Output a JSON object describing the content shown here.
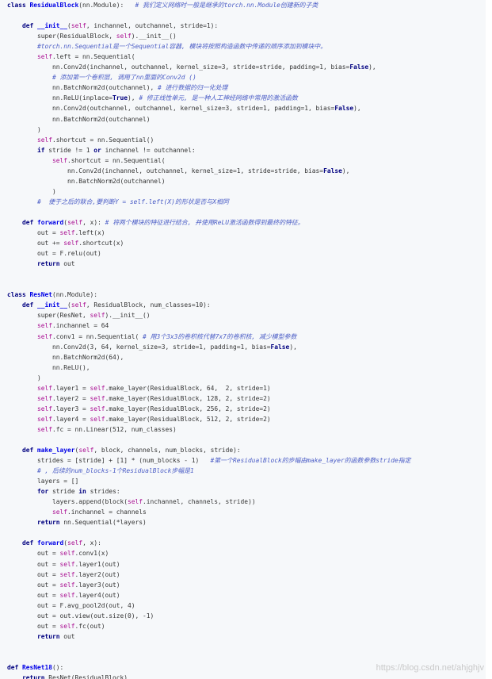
{
  "watermark": "https://blog.csdn.net/ahjghjv",
  "lines": [
    [
      [
        "kw",
        "class "
      ],
      [
        "fn",
        "ResidualBlock"
      ],
      [
        "n",
        "(nn.Module):   "
      ],
      [
        "co",
        "# 我们定义网络时一般是继承的torch.nn.Module创建新的子类"
      ]
    ],
    [
      [
        "n",
        ""
      ]
    ],
    [
      [
        "n",
        "    "
      ],
      [
        "kw",
        "def "
      ],
      [
        "fn",
        "__init__"
      ],
      [
        "n",
        "("
      ],
      [
        "self",
        "self"
      ],
      [
        "n",
        ", inchannel, outchannel, stride=1):"
      ]
    ],
    [
      [
        "n",
        "        super(ResidualBlock, "
      ],
      [
        "self",
        "self"
      ],
      [
        "n",
        ").__init__()"
      ]
    ],
    [
      [
        "n",
        "        "
      ],
      [
        "co",
        "#torch.nn.Sequential是一个Sequential容器, 模块将按照构造函数中传递的顺序添加到模块中。"
      ]
    ],
    [
      [
        "n",
        "        "
      ],
      [
        "self",
        "self"
      ],
      [
        "n",
        ".left = nn.Sequential("
      ]
    ],
    [
      [
        "n",
        "            nn.Conv2d(inchannel, outchannel, kernel_size=3, stride=stride, padding=1, bias="
      ],
      [
        "kw",
        "False"
      ],
      [
        "n",
        "),"
      ]
    ],
    [
      [
        "n",
        "            "
      ],
      [
        "co",
        "# 添加第一个卷积层, 调用了nn里面的Conv2d ()"
      ]
    ],
    [
      [
        "n",
        "            nn.BatchNorm2d(outchannel), "
      ],
      [
        "co",
        "# 进行数据的归一化处理"
      ]
    ],
    [
      [
        "n",
        "            nn.ReLU(inplace="
      ],
      [
        "kw",
        "True"
      ],
      [
        "n",
        "), "
      ],
      [
        "co",
        "# 修正线性单元, 是一种人工神经网络中常用的激活函数"
      ]
    ],
    [
      [
        "n",
        "            nn.Conv2d(outchannel, outchannel, kernel_size=3, stride=1, padding=1, bias="
      ],
      [
        "kw",
        "False"
      ],
      [
        "n",
        "),"
      ]
    ],
    [
      [
        "n",
        "            nn.BatchNorm2d(outchannel)"
      ]
    ],
    [
      [
        "n",
        "        )"
      ]
    ],
    [
      [
        "n",
        "        "
      ],
      [
        "self",
        "self"
      ],
      [
        "n",
        ".shortcut = nn.Sequential()"
      ]
    ],
    [
      [
        "n",
        "        "
      ],
      [
        "kw",
        "if "
      ],
      [
        "n",
        "stride != 1 "
      ],
      [
        "kw",
        "or "
      ],
      [
        "n",
        "inchannel != outchannel:"
      ]
    ],
    [
      [
        "n",
        "            "
      ],
      [
        "self",
        "self"
      ],
      [
        "n",
        ".shortcut = nn.Sequential("
      ]
    ],
    [
      [
        "n",
        "                nn.Conv2d(inchannel, outchannel, kernel_size=1, stride=stride, bias="
      ],
      [
        "kw",
        "False"
      ],
      [
        "n",
        "),"
      ]
    ],
    [
      [
        "n",
        "                nn.BatchNorm2d(outchannel)"
      ]
    ],
    [
      [
        "n",
        "            )"
      ]
    ],
    [
      [
        "n",
        "        "
      ],
      [
        "co",
        "#  便于之后的联合,要判断Y = self.left(X)的形状是否与X相同"
      ]
    ],
    [
      [
        "n",
        ""
      ]
    ],
    [
      [
        "n",
        "    "
      ],
      [
        "kw",
        "def "
      ],
      [
        "fn",
        "forward"
      ],
      [
        "n",
        "("
      ],
      [
        "self",
        "self"
      ],
      [
        "n",
        ", x): "
      ],
      [
        "co",
        "# 将两个模块的特征进行结合, 并使用ReLU激活函数得到最终的特征。"
      ]
    ],
    [
      [
        "n",
        "        out = "
      ],
      [
        "self",
        "self"
      ],
      [
        "n",
        ".left(x)"
      ]
    ],
    [
      [
        "n",
        "        out += "
      ],
      [
        "self",
        "self"
      ],
      [
        "n",
        ".shortcut(x)"
      ]
    ],
    [
      [
        "n",
        "        out = F.relu(out)"
      ]
    ],
    [
      [
        "n",
        "        "
      ],
      [
        "kw",
        "return "
      ],
      [
        "n",
        "out"
      ]
    ],
    [
      [
        "n",
        ""
      ]
    ],
    [
      [
        "n",
        ""
      ]
    ],
    [
      [
        "kw",
        "class "
      ],
      [
        "fn",
        "ResNet"
      ],
      [
        "n",
        "(nn.Module):"
      ]
    ],
    [
      [
        "n",
        "    "
      ],
      [
        "kw",
        "def "
      ],
      [
        "fn",
        "__init__"
      ],
      [
        "n",
        "("
      ],
      [
        "self",
        "self"
      ],
      [
        "n",
        ", ResidualBlock, num_classes=10):"
      ]
    ],
    [
      [
        "n",
        "        super(ResNet, "
      ],
      [
        "self",
        "self"
      ],
      [
        "n",
        ").__init__()"
      ]
    ],
    [
      [
        "n",
        "        "
      ],
      [
        "self",
        "self"
      ],
      [
        "n",
        ".inchannel = 64"
      ]
    ],
    [
      [
        "n",
        "        "
      ],
      [
        "self",
        "self"
      ],
      [
        "n",
        ".conv1 = nn.Sequential( "
      ],
      [
        "co",
        "# 用3个3x3的卷积核代替7x7的卷积核, 减少模型参数"
      ]
    ],
    [
      [
        "n",
        "            nn.Conv2d(3, 64, kernel_size=3, stride=1, padding=1, bias="
      ],
      [
        "kw",
        "False"
      ],
      [
        "n",
        "),"
      ]
    ],
    [
      [
        "n",
        "            nn.BatchNorm2d(64),"
      ]
    ],
    [
      [
        "n",
        "            nn.ReLU(),"
      ]
    ],
    [
      [
        "n",
        "        )"
      ]
    ],
    [
      [
        "n",
        "        "
      ],
      [
        "self",
        "self"
      ],
      [
        "n",
        ".layer1 = "
      ],
      [
        "self",
        "self"
      ],
      [
        "n",
        ".make_layer(ResidualBlock, 64,  2, stride=1)"
      ]
    ],
    [
      [
        "n",
        "        "
      ],
      [
        "self",
        "self"
      ],
      [
        "n",
        ".layer2 = "
      ],
      [
        "self",
        "self"
      ],
      [
        "n",
        ".make_layer(ResidualBlock, 128, 2, stride=2)"
      ]
    ],
    [
      [
        "n",
        "        "
      ],
      [
        "self",
        "self"
      ],
      [
        "n",
        ".layer3 = "
      ],
      [
        "self",
        "self"
      ],
      [
        "n",
        ".make_layer(ResidualBlock, 256, 2, stride=2)"
      ]
    ],
    [
      [
        "n",
        "        "
      ],
      [
        "self",
        "self"
      ],
      [
        "n",
        ".layer4 = "
      ],
      [
        "self",
        "self"
      ],
      [
        "n",
        ".make_layer(ResidualBlock, 512, 2, stride=2)"
      ]
    ],
    [
      [
        "n",
        "        "
      ],
      [
        "self",
        "self"
      ],
      [
        "n",
        ".fc = nn.Linear(512, num_classes)"
      ]
    ],
    [
      [
        "n",
        ""
      ]
    ],
    [
      [
        "n",
        "    "
      ],
      [
        "kw",
        "def "
      ],
      [
        "fn",
        "make_layer"
      ],
      [
        "n",
        "("
      ],
      [
        "self",
        "self"
      ],
      [
        "n",
        ", block, channels, num_blocks, stride):"
      ]
    ],
    [
      [
        "n",
        "        strides = [stride] + [1] * (num_blocks - 1)   "
      ],
      [
        "co",
        "#第一个ResidualBlock的步幅由make_layer的函数参数stride指定"
      ]
    ],
    [
      [
        "n",
        "        "
      ],
      [
        "co",
        "# , 后续的num_blocks-1个ResidualBlock步幅是1"
      ]
    ],
    [
      [
        "n",
        "        layers = []"
      ]
    ],
    [
      [
        "n",
        "        "
      ],
      [
        "kw",
        "for "
      ],
      [
        "n",
        "stride "
      ],
      [
        "kw",
        "in "
      ],
      [
        "n",
        "strides:"
      ]
    ],
    [
      [
        "n",
        "            layers.append(block("
      ],
      [
        "self",
        "self"
      ],
      [
        "n",
        ".inchannel, channels, stride))"
      ]
    ],
    [
      [
        "n",
        "            "
      ],
      [
        "self",
        "self"
      ],
      [
        "n",
        ".inchannel = channels"
      ]
    ],
    [
      [
        "n",
        "        "
      ],
      [
        "kw",
        "return "
      ],
      [
        "n",
        "nn.Sequential(*layers)"
      ]
    ],
    [
      [
        "n",
        ""
      ]
    ],
    [
      [
        "n",
        "    "
      ],
      [
        "kw",
        "def "
      ],
      [
        "fn",
        "forward"
      ],
      [
        "n",
        "("
      ],
      [
        "self",
        "self"
      ],
      [
        "n",
        ", x):"
      ]
    ],
    [
      [
        "n",
        "        out = "
      ],
      [
        "self",
        "self"
      ],
      [
        "n",
        ".conv1(x)"
      ]
    ],
    [
      [
        "n",
        "        out = "
      ],
      [
        "self",
        "self"
      ],
      [
        "n",
        ".layer1(out)"
      ]
    ],
    [
      [
        "n",
        "        out = "
      ],
      [
        "self",
        "self"
      ],
      [
        "n",
        ".layer2(out)"
      ]
    ],
    [
      [
        "n",
        "        out = "
      ],
      [
        "self",
        "self"
      ],
      [
        "n",
        ".layer3(out)"
      ]
    ],
    [
      [
        "n",
        "        out = "
      ],
      [
        "self",
        "self"
      ],
      [
        "n",
        ".layer4(out)"
      ]
    ],
    [
      [
        "n",
        "        out = F.avg_pool2d(out, 4)"
      ]
    ],
    [
      [
        "n",
        "        out = out.view(out.size(0), -1)"
      ]
    ],
    [
      [
        "n",
        "        out = "
      ],
      [
        "self",
        "self"
      ],
      [
        "n",
        ".fc(out)"
      ]
    ],
    [
      [
        "n",
        "        "
      ],
      [
        "kw",
        "return "
      ],
      [
        "n",
        "out"
      ]
    ],
    [
      [
        "n",
        ""
      ]
    ],
    [
      [
        "n",
        ""
      ]
    ],
    [
      [
        "kw",
        "def "
      ],
      [
        "fn",
        "ResNet18"
      ],
      [
        "n",
        "():"
      ]
    ],
    [
      [
        "n",
        "    "
      ],
      [
        "kw",
        "return "
      ],
      [
        "n",
        "ResNet(ResidualBlock)"
      ]
    ]
  ]
}
